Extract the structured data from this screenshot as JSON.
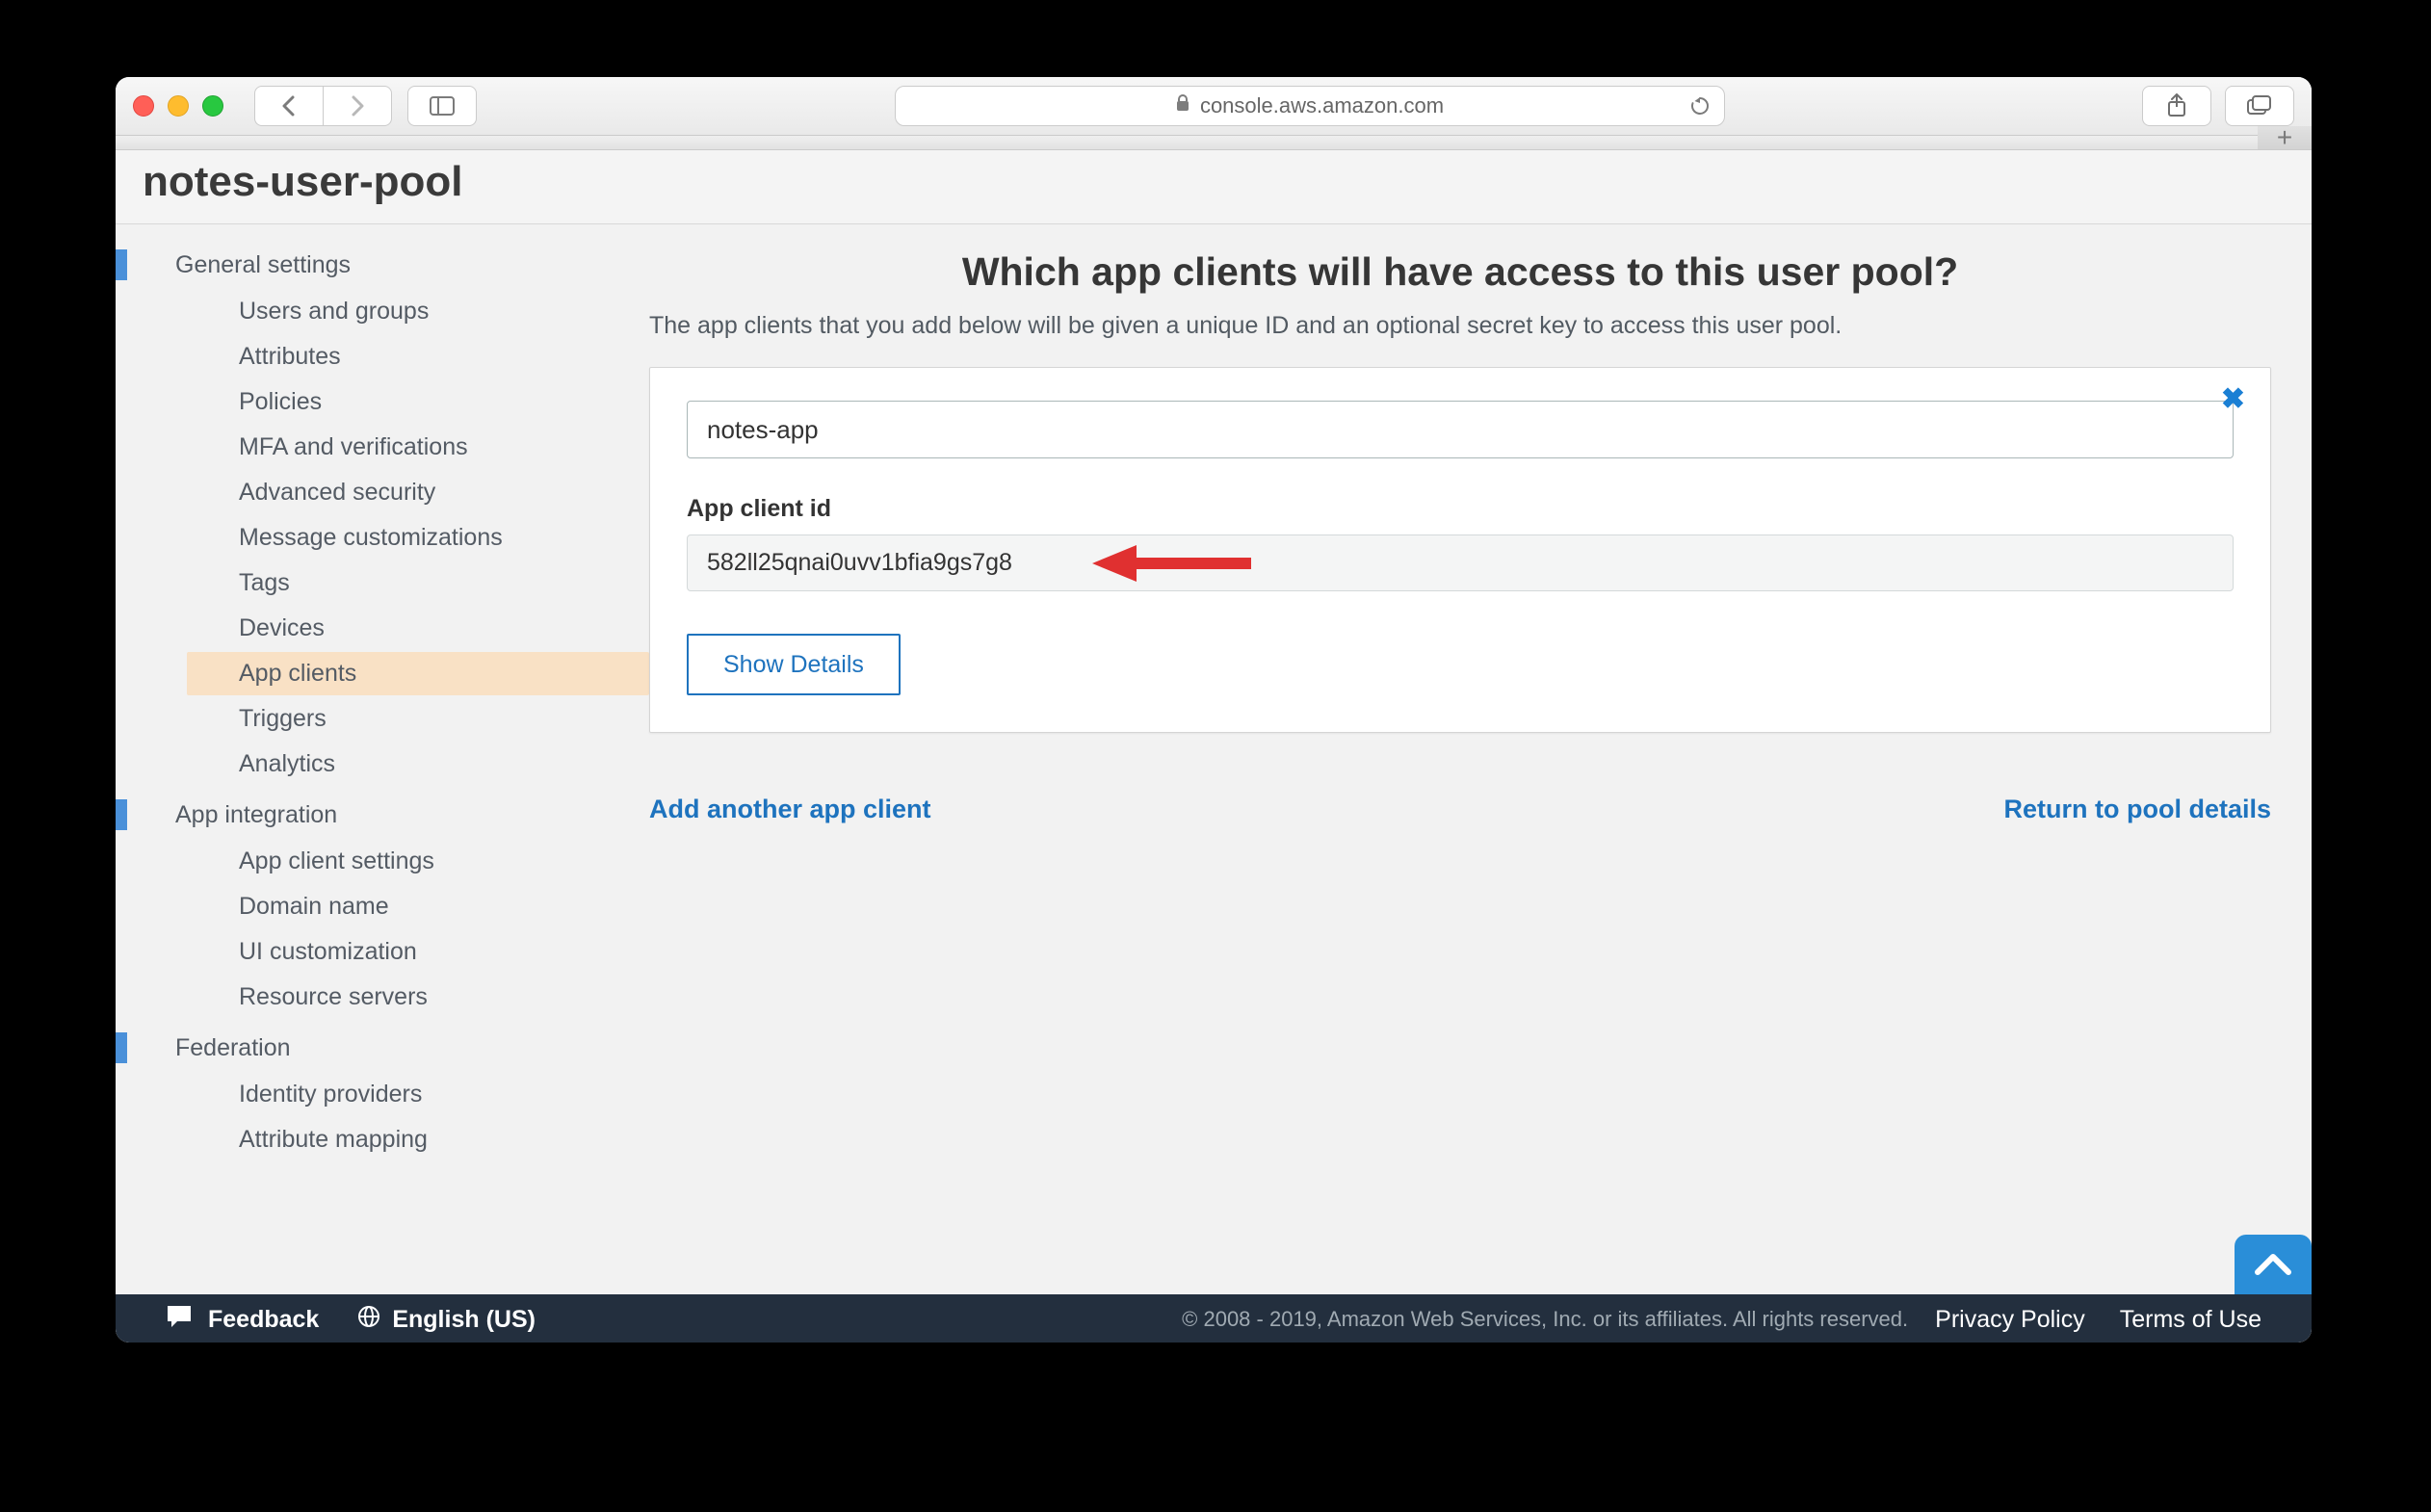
{
  "colors": {
    "accent": "#4a90d9",
    "active_nav_bg": "#f9e1c5",
    "link": "#1e73be",
    "footer_bg": "#232f3e",
    "arrow": "#e03030",
    "scroll_top": "#2a8ed8"
  },
  "browser": {
    "url_host": "console.aws.amazon.com"
  },
  "pool": {
    "title": "notes-user-pool"
  },
  "sidebar": {
    "sections": [
      {
        "label": "General settings",
        "items": [
          "Users and groups",
          "Attributes",
          "Policies",
          "MFA and verifications",
          "Advanced security",
          "Message customizations",
          "Tags",
          "Devices",
          "App clients",
          "Triggers",
          "Analytics"
        ],
        "active_index": 8
      },
      {
        "label": "App integration",
        "items": [
          "App client settings",
          "Domain name",
          "UI customization",
          "Resource servers"
        ],
        "active_index": -1
      },
      {
        "label": "Federation",
        "items": [
          "Identity providers",
          "Attribute mapping"
        ],
        "active_index": -1
      }
    ]
  },
  "main": {
    "heading": "Which app clients will have access to this user pool?",
    "description": "The app clients that you add below will be given a unique ID and an optional secret key to access this user pool.",
    "client": {
      "name": "notes-app",
      "id_label": "App client id",
      "id": "582ll25qnai0uvv1bfia9gs7g8",
      "show_details": "Show Details"
    },
    "links": {
      "add_another": "Add another app client",
      "return_pool": "Return to pool details"
    }
  },
  "footer": {
    "feedback": "Feedback",
    "language": "English (US)",
    "copyright": "© 2008 - 2019, Amazon Web Services, Inc. or its affiliates. All rights reserved.",
    "privacy": "Privacy Policy",
    "terms": "Terms of Use"
  }
}
